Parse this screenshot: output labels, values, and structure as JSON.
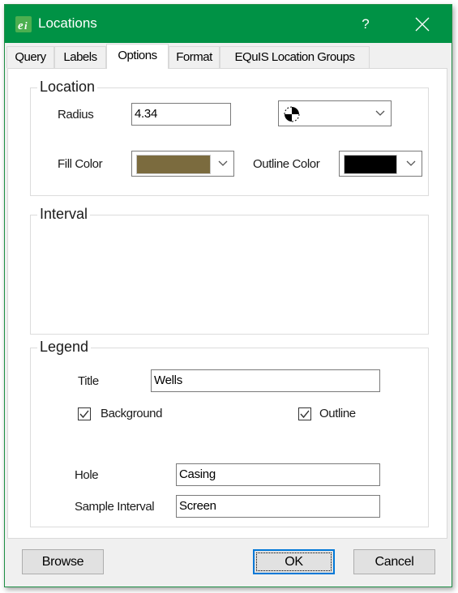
{
  "window": {
    "title": "Locations",
    "help_label": "?",
    "accent_color": "#009245"
  },
  "tabs": [
    {
      "label": "Query",
      "active": false
    },
    {
      "label": "Labels",
      "active": false
    },
    {
      "label": "Options",
      "active": true
    },
    {
      "label": "Format",
      "active": false
    },
    {
      "label": "EQuIS Location Groups",
      "active": false
    }
  ],
  "location": {
    "group_title": "Location",
    "radius_label": "Radius",
    "radius_value": "4.34",
    "symbol_selected": "quartered-circle-symbol",
    "fill_color_label": "Fill Color",
    "fill_color": "#7b6b3e",
    "outline_color_label": "Outline Color",
    "outline_color": "#000000"
  },
  "interval": {
    "group_title": "Interval"
  },
  "legend": {
    "group_title": "Legend",
    "title_label": "Title",
    "title_value": "Wells",
    "background_label": "Background",
    "background_checked": true,
    "outline_label": "Outline",
    "outline_checked": true,
    "hole_label": "Hole",
    "hole_value": "Casing",
    "sample_interval_label": "Sample Interval",
    "sample_interval_value": "Screen"
  },
  "buttons": {
    "browse": "Browse",
    "ok": "OK",
    "cancel": "Cancel"
  }
}
